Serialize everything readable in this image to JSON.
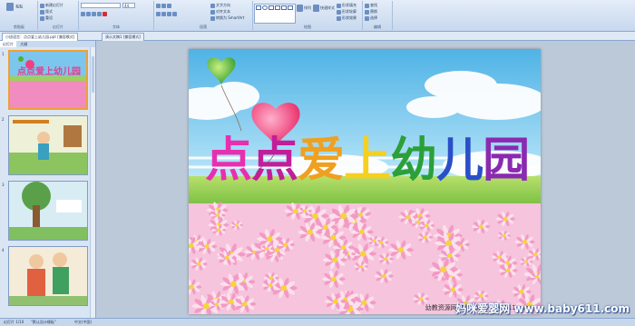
{
  "ribbon": {
    "groups": [
      "剪贴板",
      "幻灯片",
      "字体",
      "段落",
      "绘图",
      "编辑"
    ],
    "buttons": {
      "paste": "粘贴",
      "new_slide": "新建幻灯片",
      "layout": "版式",
      "reset": "重设",
      "delete": "删除",
      "text_direction": "文字方向",
      "align_text": "对齐文本",
      "convert_smartart": "转换为 SmartArt",
      "arrange": "排列",
      "quick_styles": "快速样式",
      "shape_fill": "形状填充",
      "shape_outline": "形状轮廓",
      "shape_effects": "形状效果",
      "find": "查找",
      "replace": "替换",
      "select": "选择"
    },
    "font_name": "",
    "font_size": "44"
  },
  "tabs": [
    {
      "label": "小班语言：点点爱上幼儿园.ppt [兼容模式]"
    },
    {
      "label": "演示文稿1 [兼容模式]"
    }
  ],
  "panel": {
    "tab_slides": "幻灯片",
    "tab_outline": "大纲",
    "slide_numbers": [
      "1",
      "2",
      "3",
      "4"
    ]
  },
  "slide": {
    "title_chars": [
      "点",
      "点",
      "爱",
      "上",
      "幼",
      "儿",
      "园"
    ],
    "title_colors": [
      "#e82fb0",
      "#c21d9a",
      "#f0a020",
      "#f5d020",
      "#2ca038",
      "#2a4fc8",
      "#8a2ab0"
    ],
    "thumb_title": "点点爱上幼儿园",
    "credit": "幼教资源网站 ziyuan.baby611.com"
  },
  "statusbar": {
    "slide_info": "幻灯片 1/10",
    "theme": "\"默认设计模板\"",
    "language": "中文(中国)"
  },
  "watermark": "妈咪爱婴网 www.baby611.com"
}
